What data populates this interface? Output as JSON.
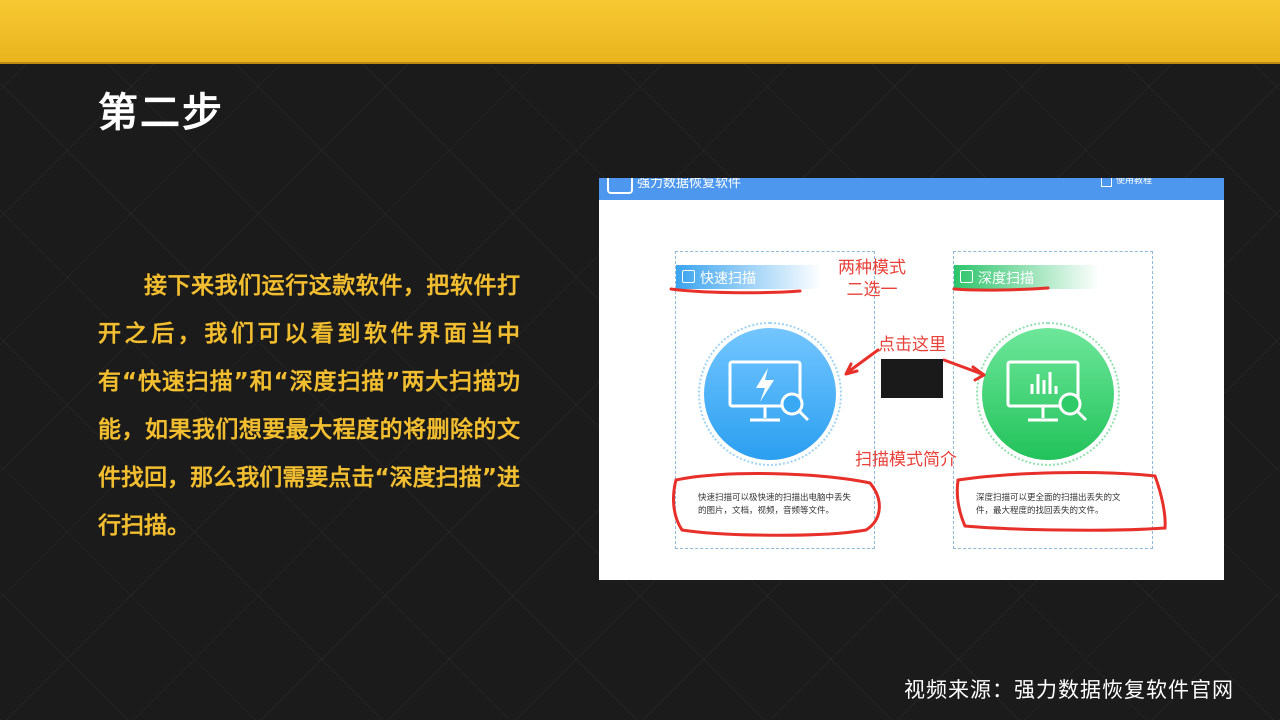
{
  "slide": {
    "title": "第二步",
    "description": "接下来我们运行这款软件，把软件打开之后，我们可以看到软件界面当中有“快速扫描”和“深度扫描”两大扫描功能，如果我们想要最大程度的将删除的文件找回，那么我们需要点击“深度扫描”进行扫描。",
    "source": "视频来源：强力数据恢复软件官网"
  },
  "screenshot": {
    "app_title": "强力数据恢复软件",
    "help_label": "使用教程",
    "quick_scan": {
      "label": "快速扫描",
      "desc": "快速扫描可以极快速的扫描出电脑中丢失的图片，文档，视频，音频等文件。"
    },
    "deep_scan": {
      "label": "深度扫描",
      "desc": "深度扫描可以更全面的扫描出丢失的文件，最大程度的找回丢失的文件。"
    }
  },
  "annotations": {
    "modes_line1": "两种模式",
    "modes_line2": "二选一",
    "click_here": "点击这里",
    "intro": "扫描模式简介"
  },
  "colors": {
    "accent_yellow": "#f2be2f",
    "annotation_red": "#e8413a",
    "app_blue": "#4e97ee",
    "quick_blue": "#2b9ff0",
    "deep_green": "#22c25b"
  }
}
